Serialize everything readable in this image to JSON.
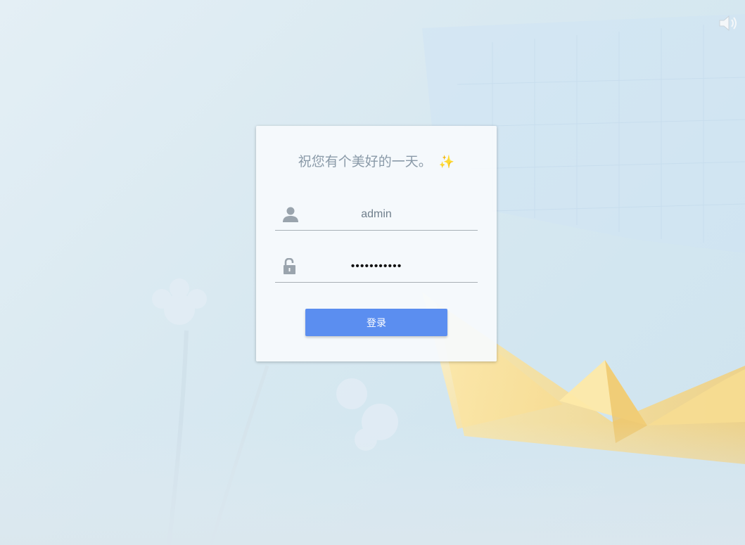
{
  "greeting": {
    "text": "祝您有个美好的一天。",
    "emoji": "✨"
  },
  "username_field": {
    "icon": "user-icon",
    "value": "admin"
  },
  "password_field": {
    "icon": "unlock-icon",
    "value": "•••••••••••"
  },
  "login_button": {
    "label": "登录",
    "color": "#5b8ef0"
  },
  "sound_toggle": {
    "icon": "speaker-icon"
  }
}
